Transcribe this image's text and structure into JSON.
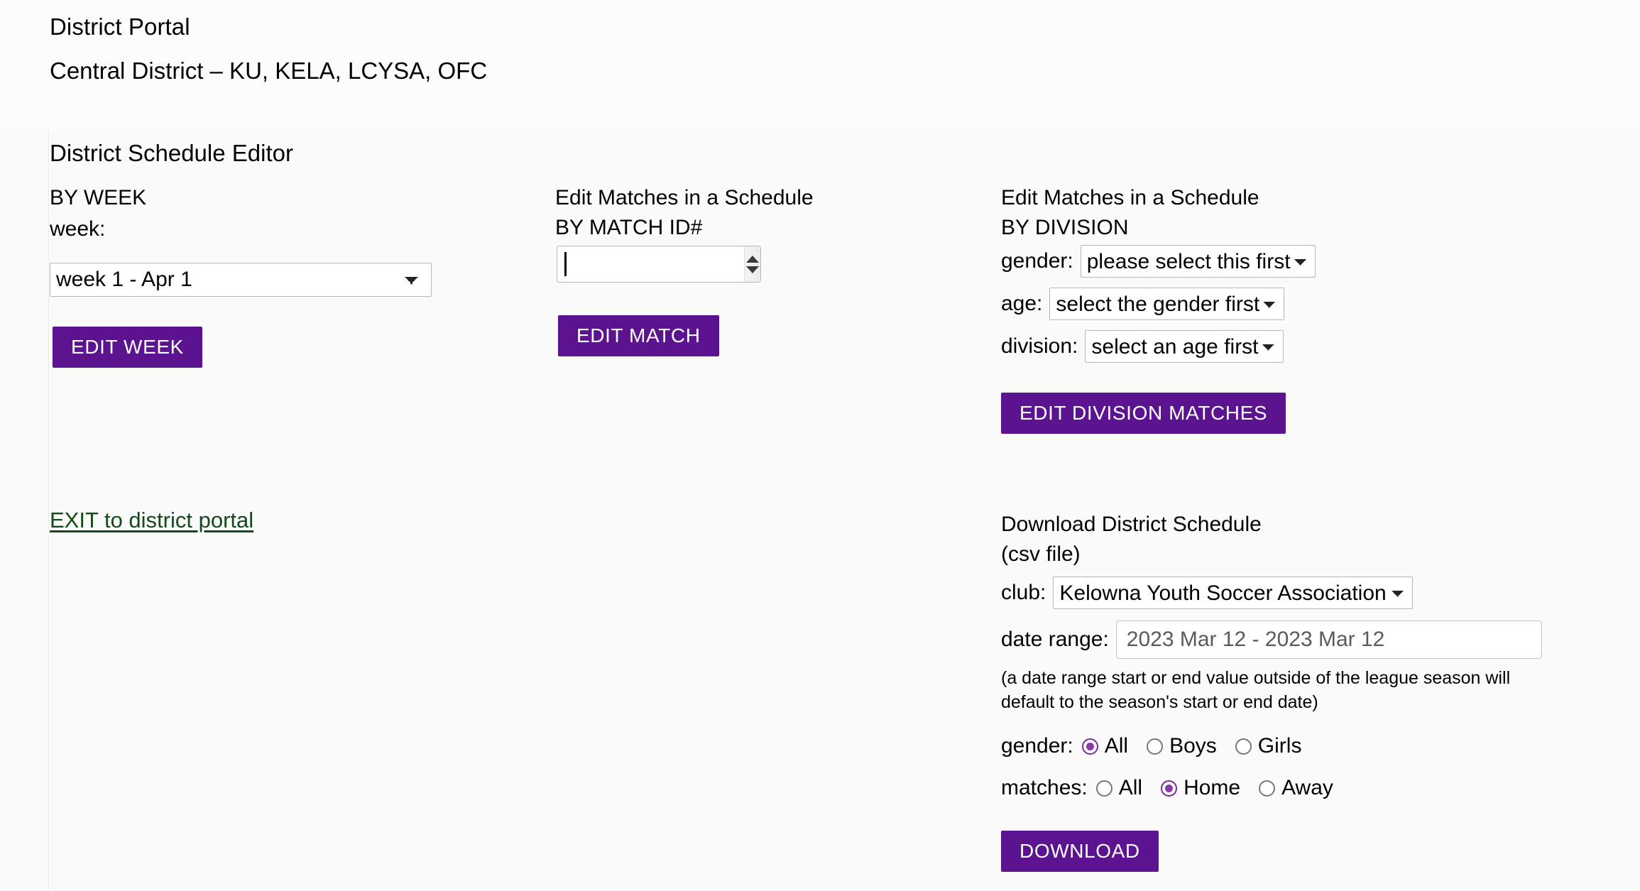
{
  "header": {
    "portal_title": "District Portal",
    "portal_subtitle": "Central District – KU, KELA, LCYSA, OFC",
    "editor_title": "District Schedule Editor"
  },
  "by_week": {
    "heading": "BY WEEK",
    "week_label": "week:",
    "week_value": "week 1 - Apr 1",
    "week_options": [
      "week 1 - Apr 1"
    ],
    "edit_button": "EDIT WEEK"
  },
  "by_match_id": {
    "heading": "Edit Matches in a Schedule\nBY MATCH ID#",
    "match_id_value": "",
    "match_id_placeholder": "",
    "spinner_up_icon": "triangle-up-icon",
    "spinner_down_icon": "triangle-down-icon",
    "edit_button": "EDIT MATCH"
  },
  "by_division": {
    "heading": "Edit Matches in a Schedule\nBY DIVISION",
    "gender_label": "gender:",
    "gender_value": "please select this first",
    "gender_options": [
      "please select this first"
    ],
    "age_label": "age:",
    "age_value": "select the gender first",
    "age_options": [
      "select the gender first"
    ],
    "division_label": "division:",
    "division_value": "select an age first",
    "division_options": [
      "select an age first"
    ],
    "edit_button": "EDIT DIVISION MATCHES"
  },
  "exit": {
    "link_text": "EXIT to district portal",
    "link_color": "#14491a"
  },
  "download": {
    "heading": "Download District Schedule\n(csv file)",
    "club_label": "club:",
    "club_value": "Kelowna Youth Soccer Association",
    "club_options": [
      "Kelowna Youth Soccer Association"
    ],
    "date_range_label": "date range:",
    "date_range_value": "2023 Mar 12 - 2023 Mar 12",
    "note": "(a date range start or end value outside of the league season will\ndefault to the season's start or end date)",
    "gender_label": "gender:",
    "gender_options": [
      {
        "label": "All",
        "selected": true
      },
      {
        "label": "Boys",
        "selected": false
      },
      {
        "label": "Girls",
        "selected": false
      }
    ],
    "matches_label": "matches:",
    "matches_options": [
      {
        "label": "All",
        "selected": false
      },
      {
        "label": "Home",
        "selected": true
      },
      {
        "label": "Away",
        "selected": false
      }
    ],
    "download_button": "DOWNLOAD"
  },
  "theme": {
    "button_purple": "#5b1390",
    "radio_purple": "#8a3aa8",
    "page_background": "#fbfbfb"
  }
}
